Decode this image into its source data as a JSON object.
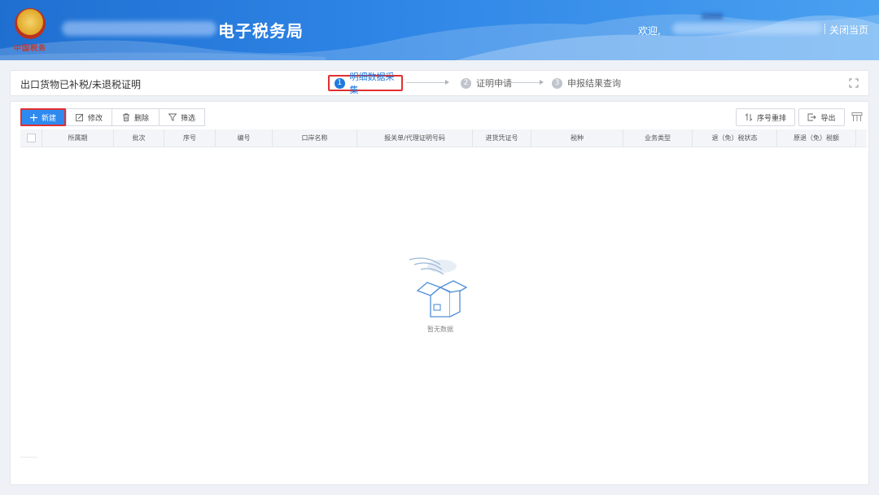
{
  "header": {
    "emblem_text": "中国税务",
    "site_title": "电子税务局",
    "welcome": "欢迎,",
    "close_page": "关闭当页"
  },
  "stepbar": {
    "page_name": "出口货物已补税/未退税证明",
    "steps": [
      {
        "num": "1",
        "label": "明细数据采集"
      },
      {
        "num": "2",
        "label": "证明申请"
      },
      {
        "num": "3",
        "label": "申报结果查询"
      }
    ]
  },
  "toolbar": {
    "new_label": "新建",
    "edit_label": "修改",
    "delete_label": "删除",
    "filter_label": "筛选",
    "reorder_label": "序号重排",
    "export_label": "导出"
  },
  "table": {
    "columns": [
      "所属期",
      "批次",
      "序号",
      "编号",
      "口岸名称",
      "报关单/代理证明号码",
      "进货凭证号",
      "税种",
      "业务类型",
      "退（免）税状态",
      "原退（免）税额",
      " "
    ]
  },
  "empty": {
    "text": "暂无数据"
  },
  "colors": {
    "primary": "#2f8af0",
    "highlight": "#e03030",
    "header": "#1f6fd1"
  }
}
